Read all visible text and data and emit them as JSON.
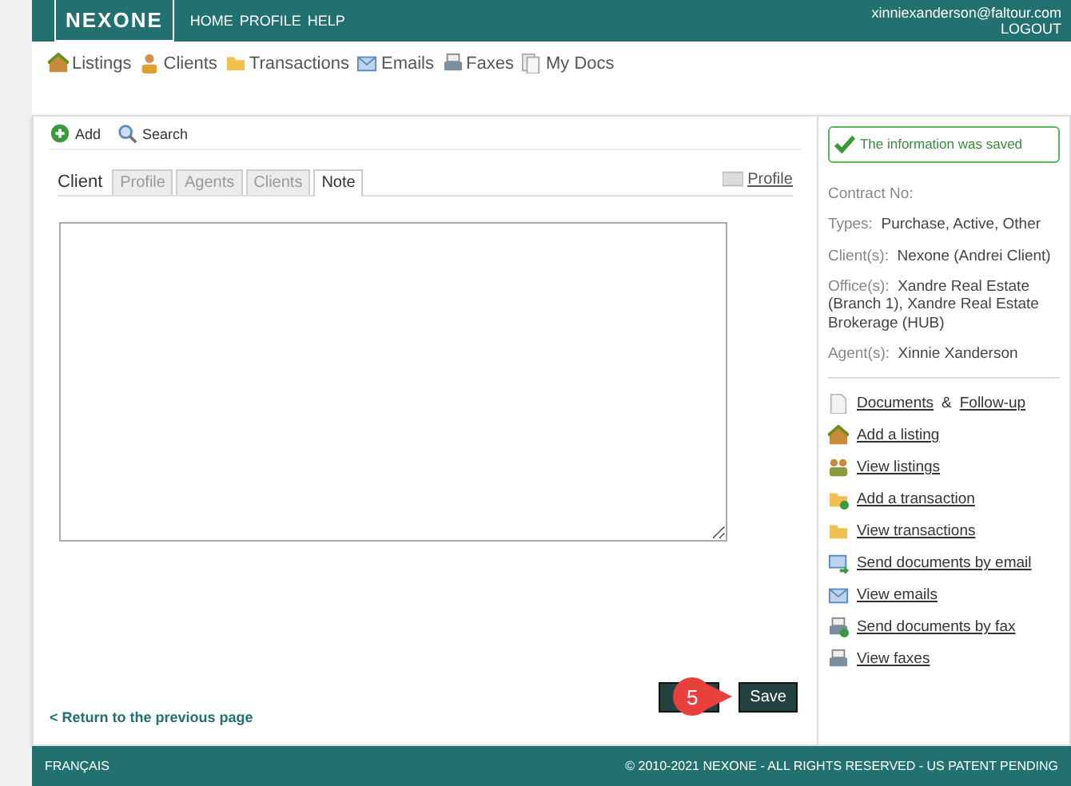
{
  "header": {
    "logo": "NEXONE",
    "menu": [
      "HOME",
      "PROFILE",
      "HELP"
    ],
    "user_email": "xinniexanderson@faltour.com",
    "logout": "LOGOUT"
  },
  "nav": [
    {
      "label": "Listings",
      "kind": "house"
    },
    {
      "label": "Clients",
      "kind": "person"
    },
    {
      "label": "Transactions",
      "kind": "folder"
    },
    {
      "label": "Emails",
      "kind": "mail"
    },
    {
      "label": "Faxes",
      "kind": "printer"
    },
    {
      "label": "My Docs",
      "kind": "docs"
    }
  ],
  "toolbar": [
    {
      "label": "Add",
      "kind": "add"
    },
    {
      "label": "Search",
      "kind": "search"
    }
  ],
  "tabs_title": "Client",
  "tabs": [
    {
      "label": "Profile",
      "selected": false
    },
    {
      "label": "Agents",
      "selected": false
    },
    {
      "label": "Clients",
      "selected": false
    },
    {
      "label": "Note",
      "selected": true
    }
  ],
  "profile_link": "Profile",
  "back_link": "< Return to the previous page",
  "buttons": [
    {
      "kind": "cancel"
    },
    {
      "label": "Save",
      "kind": "save"
    }
  ],
  "annotation": {
    "label": "5"
  },
  "sidebar": {
    "message": "The information was saved",
    "details": [
      {
        "label": "Contract No:"
      },
      {
        "label": "Types:",
        "value": "Purchase, Active, Other"
      },
      {
        "label": "Client(s):",
        "value": "Nexone (Andrei Client)"
      },
      {
        "label": "Office(s):",
        "value": "Xandre Real Estate (Branch 1), Xandre Real Estate Brokerage (HUB)"
      },
      {
        "label": "Agent(s):",
        "value": "Xinnie Xanderson"
      }
    ],
    "documents": {
      "link": "Documents",
      "joiner": "&",
      "link2": "Follow-up"
    },
    "links": [
      {
        "label": "Add a listing",
        "kind": "house"
      },
      {
        "label": "View listings",
        "kind": "people"
      },
      {
        "label": "Add a transaction",
        "kind": "folder-add"
      },
      {
        "label": "View transactions",
        "kind": "folder"
      },
      {
        "label": "Send documents by email",
        "kind": "mail-send"
      },
      {
        "label": "View emails",
        "kind": "mail"
      },
      {
        "label": "Send documents by fax",
        "kind": "printer-send"
      },
      {
        "label": "View faxes",
        "kind": "printer"
      }
    ]
  },
  "footer": {
    "language": "FRANÇAIS",
    "copyright": "© 2010-2021 NEXONE - ALL RIGHTS RESERVED - US PATENT PENDING"
  }
}
